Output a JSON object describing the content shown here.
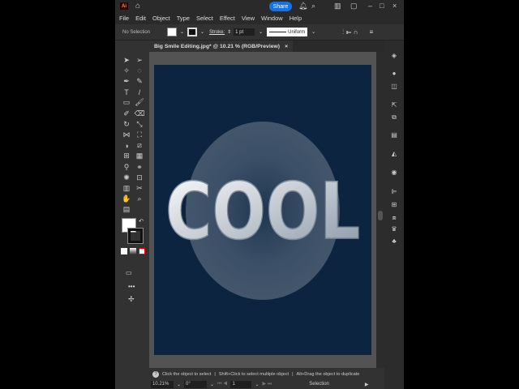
{
  "app": {
    "logo": "Ai",
    "share_label": "Share"
  },
  "menu": [
    "File",
    "Edit",
    "Object",
    "Type",
    "Select",
    "Effect",
    "View",
    "Window",
    "Help"
  ],
  "control": {
    "selection": "No Selection",
    "stroke_label": "Stroke:",
    "stroke_value": "1 pt",
    "profile": "Uniform"
  },
  "document": {
    "tab_title": "Big Smile Editing.jpg* @ 10.21 % (RGB/Preview)",
    "close": "×"
  },
  "artwork": {
    "text": "COOL"
  },
  "hint": {
    "parts": [
      "Click the object to select",
      "Shift+Click to select multiple object",
      "Alt+Drag the object to duplicate"
    ],
    "sep": "|"
  },
  "status": {
    "zoom": "10.21%",
    "rotation": "0°",
    "artboard": "1",
    "tool": "Selection"
  },
  "colors": {
    "accent": "#1473e6",
    "artboard": "#0c2440"
  }
}
